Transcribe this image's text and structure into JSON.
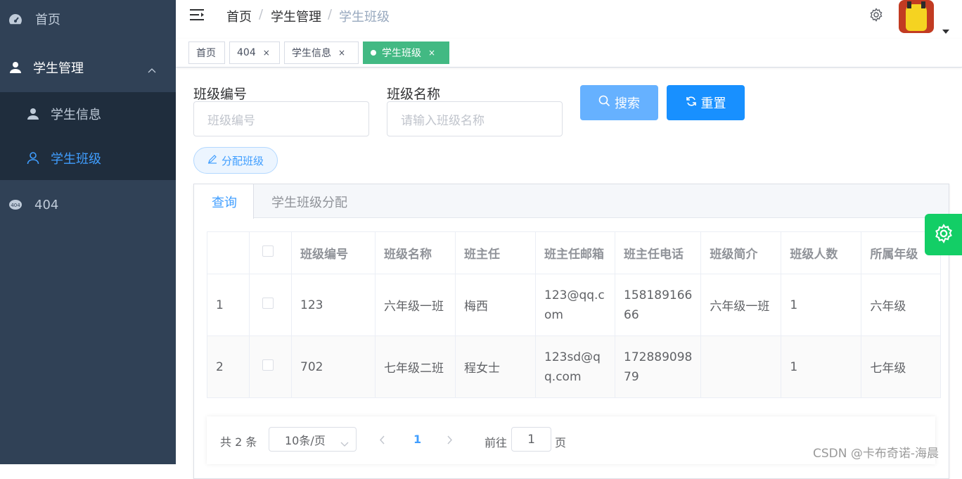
{
  "sidebar": {
    "items": [
      {
        "label": "首页",
        "icon": "dashboard-icon"
      },
      {
        "label": "学生管理",
        "icon": "user-icon"
      },
      {
        "label": "学生信息",
        "icon": "user-icon"
      },
      {
        "label": "学生班级",
        "icon": "user-outline-icon"
      },
      {
        "label": "404",
        "icon": "404-icon"
      }
    ]
  },
  "navbar": {
    "breadcrumb": [
      "首页",
      "学生管理",
      "学生班级"
    ],
    "separator": "/"
  },
  "tags": [
    {
      "label": "首页"
    },
    {
      "label": "404",
      "close": "×"
    },
    {
      "label": "学生信息",
      "close": "×"
    },
    {
      "label": "学生班级",
      "close": "×"
    }
  ],
  "form": {
    "class_no_label": "班级编号",
    "class_no_placeholder": "班级编号",
    "class_name_label": "班级名称",
    "class_name_placeholder": "请输入班级名称",
    "search_label": "搜索",
    "reset_label": "重置",
    "assign_label": "分配班级"
  },
  "tabs": [
    {
      "label": "查询"
    },
    {
      "label": "学生班级分配"
    }
  ],
  "table": {
    "headers": [
      "班级编号",
      "班级名称",
      "班主任",
      "班主任邮箱",
      "班主任电话",
      "班级简介",
      "班级人数",
      "所属年级"
    ],
    "rows": [
      {
        "index": "1",
        "no": "123",
        "name": "六年级一班",
        "teacher": "梅西",
        "email_1": "123@qq.c",
        "email_2": "om",
        "phone_1": "158189166",
        "phone_2": "66",
        "intro": "六年级一班",
        "count": "1",
        "grade": "六年级"
      },
      {
        "index": "2",
        "no": "702",
        "name": "七年级二班",
        "teacher": "程女士",
        "email_1": "123sd@q",
        "email_2": "q.com",
        "phone_1": "172889098",
        "phone_2": "79",
        "intro": "",
        "count": "1",
        "grade": "七年级"
      }
    ]
  },
  "pagination": {
    "total": "共 2 条",
    "page_size": "10条/页",
    "current": "1",
    "goto_label": "前往",
    "goto_value": "1",
    "page_suffix": "页"
  },
  "watermark": "CSDN @卡布奇诺-海晨",
  "colors": {
    "sidebar": "#304156",
    "submenu": "#1f2d3d",
    "primary": "#409eff",
    "tag_active": "#42b983",
    "fab": "#13ce66"
  }
}
